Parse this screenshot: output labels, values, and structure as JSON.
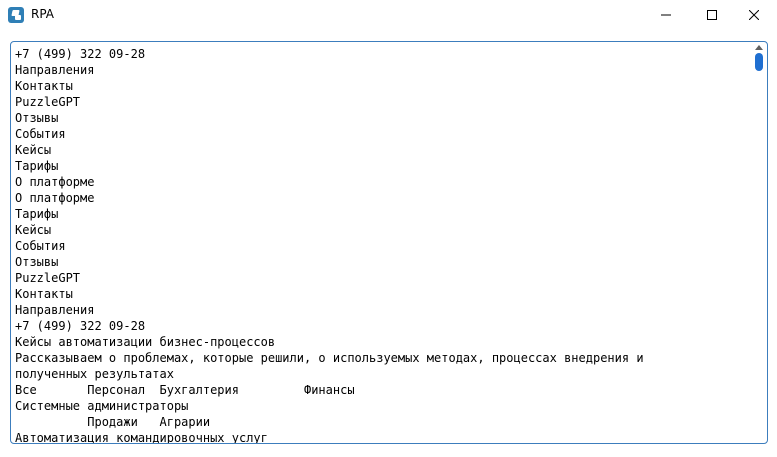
{
  "window": {
    "title": "RPA"
  },
  "text_content": {
    "lines": [
      "+7 (499) 322 09-28",
      "Направления",
      "Контакты",
      "PuzzleGPT",
      "Отзывы",
      "События",
      "Кейсы",
      "Тарифы",
      "О платформе",
      "О платформе",
      "Тарифы",
      "Кейсы",
      "События",
      "Отзывы",
      "PuzzleGPT",
      "Контакты",
      "Направления",
      "+7 (499) 322 09-28",
      "Кейсы автоматизации бизнес-процессов",
      "Рассказываем о проблемах, которые решили, о используемых методах, процессах внедрения и",
      "полученных результатах",
      "Все       Персонал  Бухгалтерия         Финансы",
      "Системные администраторы",
      "          Продажи   Аграрии",
      "Автоматизация командировочных услуг"
    ]
  },
  "colors": {
    "accent": "#1f6fd1",
    "border": "#3c7dbd"
  },
  "icons": {
    "app": "rpa-app-icon",
    "minimize": "minimize-icon",
    "maximize": "maximize-icon",
    "close": "close-icon"
  }
}
